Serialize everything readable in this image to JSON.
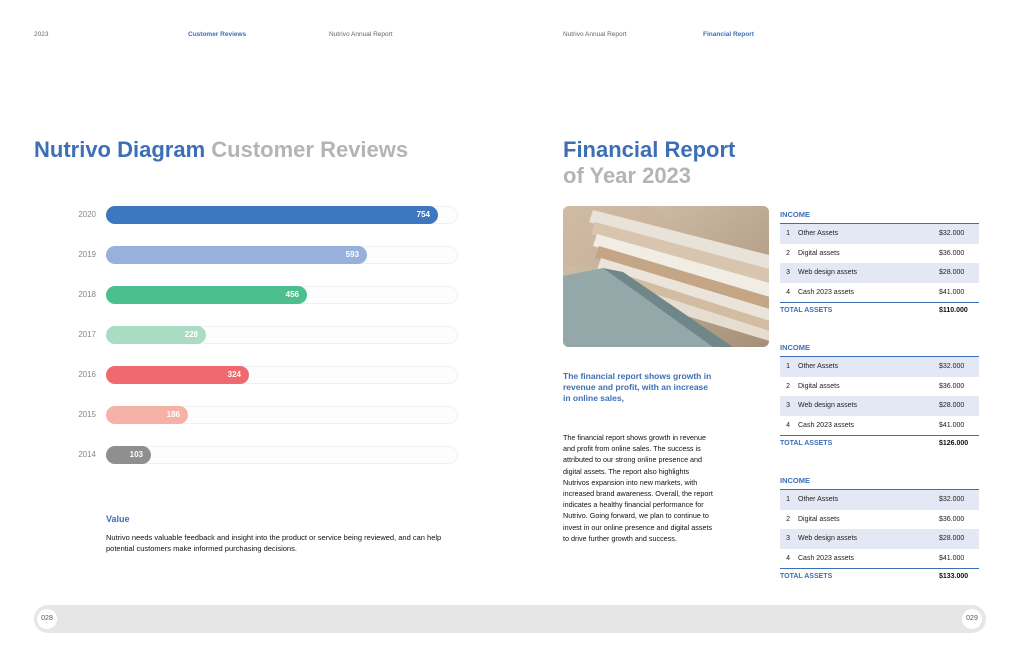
{
  "header": {
    "year": "2023",
    "left_section": "Customer Reviews",
    "left_report": "Nutrivo Annual Report",
    "right_report": "Nutrivo Annual Report",
    "right_section": "Financial Report"
  },
  "left_page": {
    "title_blue": "Nutrivo Diagram",
    "title_grey": "Customer Reviews",
    "value_heading": "Value",
    "value_text": "Nutrivo needs valuable feedback and insight into the product or service being reviewed, and can help potential customers make informed purchasing decisions.",
    "page_number": "028"
  },
  "chart_data": {
    "type": "bar",
    "orientation": "horizontal",
    "categories": [
      "2020",
      "2019",
      "2018",
      "2017",
      "2016",
      "2015",
      "2014"
    ],
    "values": [
      754,
      593,
      456,
      228,
      324,
      186,
      103
    ],
    "colors": [
      "#3d77c0",
      "#97b0dc",
      "#4dbf8e",
      "#a9dcc3",
      "#ef6a6e",
      "#f7b2a8",
      "#8f8f8f"
    ],
    "xlim": [
      0,
      800
    ],
    "grid": false
  },
  "right_page": {
    "title_line1": "Financial Report",
    "title_line2": "of Year 2023",
    "lead": "The financial report shows growth in revenue and profit, with an increase in online sales,",
    "body": "The financial report shows growth in revenue and profit from online sales. The success is attributed to our strong online presence and digital assets. The report also highlights Nutrivos expansion into new markets, with increased brand awareness. Overall, the report indicates a healthy financial performance for Nutrivo. Going forward, we plan to continue to invest in our online presence and digital assets to drive further growth and success.",
    "page_number": "029"
  },
  "tables": [
    {
      "title": "INCOME",
      "rows": [
        {
          "n": "1",
          "label": "Other Assets",
          "value": "$32.000"
        },
        {
          "n": "2",
          "label": "Digital assets",
          "value": "$36.000"
        },
        {
          "n": "3",
          "label": "Web design assets",
          "value": "$28.000"
        },
        {
          "n": "4",
          "label": "Cash 2023 assets",
          "value": "$41.000"
        }
      ],
      "total_label": "TOTAL ASSETS",
      "total_value": "$110.000"
    },
    {
      "title": "INCOME",
      "rows": [
        {
          "n": "1",
          "label": "Other Assets",
          "value": "$32.000"
        },
        {
          "n": "2",
          "label": "Digital assets",
          "value": "$36.000"
        },
        {
          "n": "3",
          "label": "Web design assets",
          "value": "$28.000"
        },
        {
          "n": "4",
          "label": "Cash 2023 assets",
          "value": "$41.000"
        }
      ],
      "total_label": "TOTAL ASSETS",
      "total_value": "$126.000"
    },
    {
      "title": "INCOME",
      "rows": [
        {
          "n": "1",
          "label": "Other Assets",
          "value": "$32.000"
        },
        {
          "n": "2",
          "label": "Digital assets",
          "value": "$36.000"
        },
        {
          "n": "3",
          "label": "Web design assets",
          "value": "$28.000"
        },
        {
          "n": "4",
          "label": "Cash 2023 assets",
          "value": "$41.000"
        }
      ],
      "total_label": "TOTAL ASSETS",
      "total_value": "$133.000"
    }
  ]
}
